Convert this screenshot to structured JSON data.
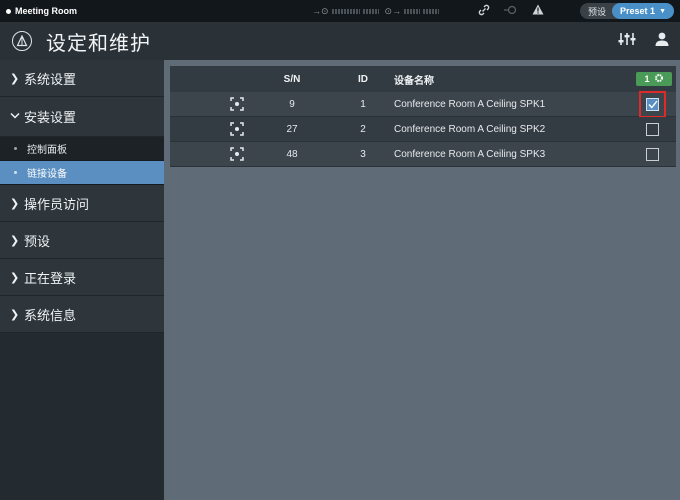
{
  "statusbar": {
    "room_name": "Meeting Room",
    "preset_label": "预设",
    "preset_value": "Preset 1"
  },
  "header": {
    "title": "设定和维护"
  },
  "sidebar": {
    "items": [
      {
        "label": "系统设置",
        "expanded": false
      },
      {
        "label": "安装设置",
        "expanded": true,
        "children": [
          {
            "label": "控制面板",
            "active": false
          },
          {
            "label": "链接设备",
            "active": true
          }
        ]
      },
      {
        "label": "操作员访问",
        "expanded": false
      },
      {
        "label": "预设",
        "expanded": false
      },
      {
        "label": "正在登录",
        "expanded": false
      },
      {
        "label": "系统信息",
        "expanded": false
      }
    ]
  },
  "table": {
    "columns": {
      "sn": "S/N",
      "id": "ID",
      "name": "设备名称"
    },
    "badge_count": "1",
    "rows": [
      {
        "sn": "9",
        "id": "1",
        "name": "Conference Room A Ceiling SPK1",
        "checked": true
      },
      {
        "sn": "27",
        "id": "2",
        "name": "Conference Room A Ceiling SPK2",
        "checked": false
      },
      {
        "sn": "48",
        "id": "3",
        "name": "Conference Room A Ceiling SPK3",
        "checked": false
      }
    ]
  },
  "icons": {
    "logo": "audio-technica-logo-icon",
    "mixer": "mixer-sliders-icon",
    "user": "user-icon",
    "identify": "identify-target-icon",
    "settings": "gear-icon"
  },
  "colors": {
    "accent": "#5b8fc1",
    "badge": "#4a9b57",
    "highlight": "#e02a2a"
  }
}
